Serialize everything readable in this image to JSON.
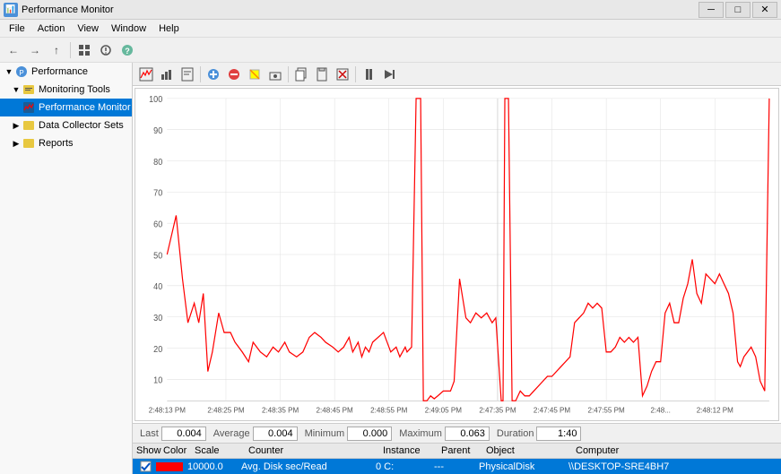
{
  "titleBar": {
    "title": "Performance Monitor",
    "icon": "📊",
    "btnMin": "─",
    "btnMax": "□",
    "btnClose": "✕"
  },
  "menuBar": {
    "items": [
      "File",
      "Action",
      "View",
      "Window",
      "Help"
    ]
  },
  "toolbar": {
    "buttons": [
      "←",
      "→",
      "↑",
      "📋",
      "⚙",
      "🖥"
    ]
  },
  "sidebar": {
    "root": "Performance",
    "items": [
      {
        "label": "Monitoring Tools",
        "level": 1,
        "expand": "▼",
        "icon": "📁"
      },
      {
        "label": "Performance Monitor",
        "level": 2,
        "expand": "",
        "icon": "📊",
        "selected": true
      },
      {
        "label": "Data Collector Sets",
        "level": 1,
        "expand": "▶",
        "icon": "📁"
      },
      {
        "label": "Reports",
        "level": 1,
        "expand": "▶",
        "icon": "📁"
      }
    ]
  },
  "chartToolbar": {
    "buttons": [
      {
        "name": "add",
        "icon": "✚"
      },
      {
        "name": "remove",
        "icon": "✖"
      },
      {
        "name": "properties",
        "icon": "✏"
      },
      {
        "name": "freeze",
        "icon": "⏸"
      },
      {
        "name": "update",
        "icon": "⏭"
      }
    ]
  },
  "chart": {
    "yAxis": [
      "100",
      "90",
      "80",
      "70",
      "60",
      "50",
      "40",
      "30",
      "20",
      "10"
    ],
    "xAxis": [
      "2:48:13 PM",
      "2:48:25 PM",
      "2:48:35 PM",
      "2:48:45 PM",
      "2:48:55 PM",
      "2:49:05 PM",
      "2:47:35 PM",
      "2:47:45 PM",
      "2:47:55 PM",
      "2:48...",
      "2:48:12 PM"
    ]
  },
  "stats": {
    "last_label": "Last",
    "last_value": "0.004",
    "avg_label": "Average",
    "avg_value": "0.004",
    "min_label": "Minimum",
    "min_value": "0.000",
    "max_label": "Maximum",
    "max_value": "0.063",
    "dur_label": "Duration",
    "dur_value": "1:40"
  },
  "counterTable": {
    "headers": [
      "Show",
      "Color",
      "Scale",
      "Counter",
      "Instance",
      "Parent",
      "Object",
      "Computer"
    ],
    "headerWidths": [
      30,
      35,
      60,
      130,
      60,
      45,
      90,
      120
    ],
    "rows": [
      {
        "show": true,
        "color": "#FF0000",
        "scale": "10000.0",
        "counter": "Avg. Disk sec/Read",
        "instance": "0 C:",
        "parent": "---",
        "object": "PhysicalDisk",
        "computer": "\\\\DESKTOP-SRE4BH7"
      }
    ]
  }
}
